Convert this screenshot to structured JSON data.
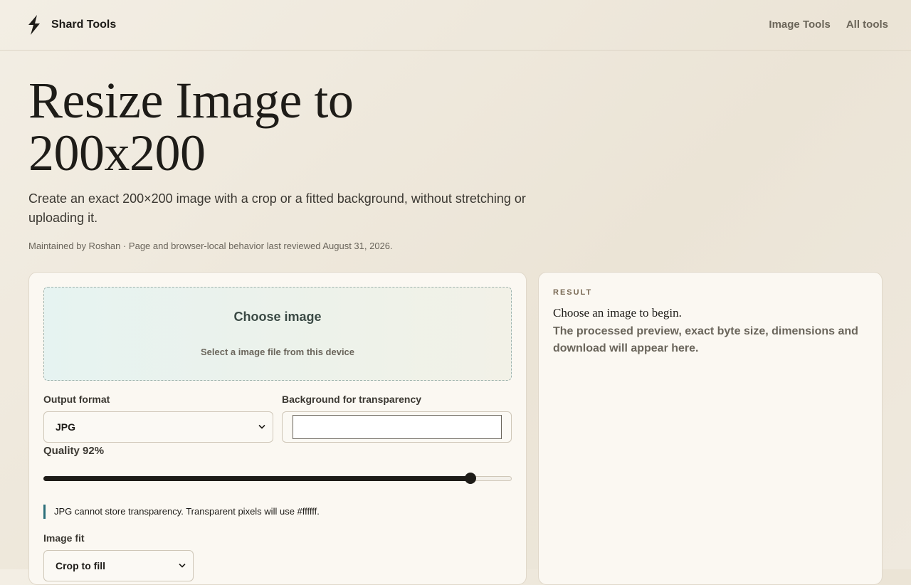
{
  "header": {
    "brand_name": "Shard Tools",
    "nav": [
      "Image Tools",
      "All tools"
    ]
  },
  "hero": {
    "title": "Resize Image to 200x200",
    "subtitle": "Create an exact 200×200 image with a crop or a fitted background, without stretching or uploading it.",
    "meta": "Maintained by Roshan · Page and browser-local behavior last reviewed August 31, 2026."
  },
  "dropzone": {
    "title": "Choose image",
    "subtitle": "Select a image file from this device"
  },
  "form": {
    "format_label": "Output format",
    "format_value": "JPG",
    "background_label": "Background for transparency",
    "background_color": "#ffffff",
    "quality_label": "Quality 92%",
    "quality_value": 92,
    "note": "JPG cannot store transparency. Transparent pixels will use #ffffff.",
    "fit_label": "Image fit",
    "fit_value": "Crop to fill"
  },
  "result": {
    "label": "RESULT",
    "main": "Choose an image to begin.",
    "sub": "The processed preview, exact byte size, dimensions and download will appear here."
  },
  "icons": {
    "logo": "lightning-bolt-icon",
    "select_chevron": "chevron-down-icon"
  },
  "colors": {
    "accent": "#2c6f7a",
    "ink": "#1e1c18"
  }
}
